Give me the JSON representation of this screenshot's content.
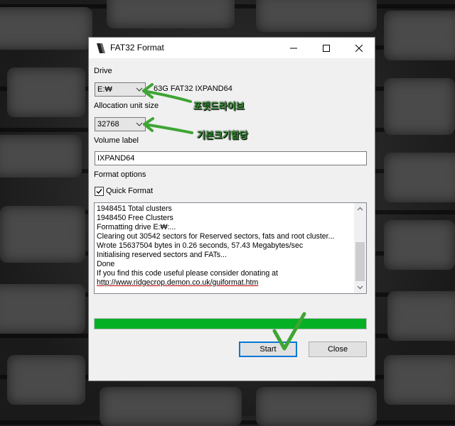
{
  "window": {
    "title": "FAT32 Format",
    "minimize_icon": "minimize-icon",
    "maximize_icon": "maximize-icon",
    "close_icon": "close-icon"
  },
  "drive": {
    "label": "Drive",
    "value": "E:₩",
    "info": "63G FAT32 IXPAND64"
  },
  "allocation": {
    "label": "Allocation unit size",
    "value": "32768"
  },
  "volume": {
    "label": "Volume label",
    "value": "IXPAND64"
  },
  "format_options": {
    "label": "Format options",
    "quick_format_label": "Quick Format",
    "quick_format_checked": true
  },
  "log": [
    "1948451 Total clusters",
    "1948450 Free Clusters",
    "Formatting drive E:₩:...",
    "Clearing out 30542 sectors for Reserved sectors, fats and root cluster...",
    "Wrote 15637504 bytes in 0.26 seconds, 57.43 Megabytes/sec",
    "Initialising reserved sectors and FATs...",
    "Done",
    "If you find this code useful please consider donating at",
    "http://www.ridgecrop.demon.co.uk/guiformat.htm"
  ],
  "progress": {
    "value_percent": 100,
    "color": "#06b025"
  },
  "buttons": {
    "start": "Start",
    "close": "Close"
  },
  "annotations": {
    "drive_note": "포맷드라이브",
    "alloc_note": "기본크기할당",
    "color": "#3fa535"
  }
}
